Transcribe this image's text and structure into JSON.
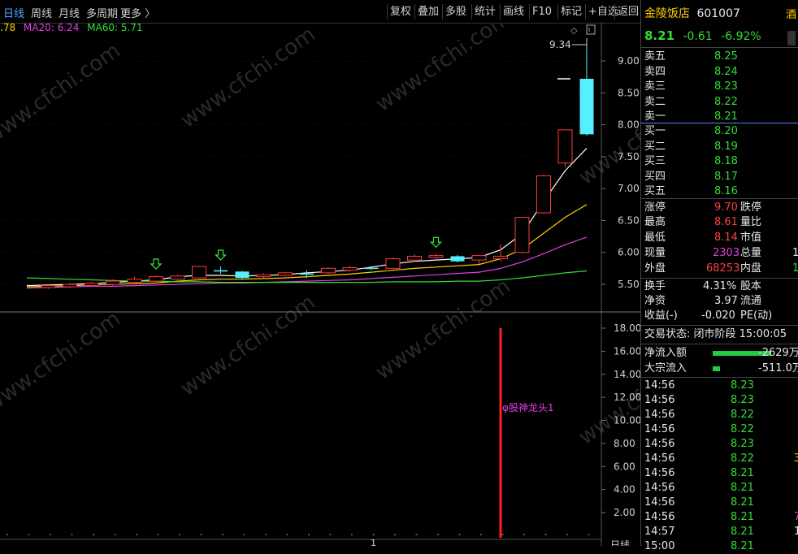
{
  "toolbar": {
    "periods": [
      "日线",
      "周线",
      "月线",
      "多周期",
      "更多 〉"
    ],
    "active_period": "日线",
    "buttons": [
      "复权",
      "叠加",
      "多股",
      "统计",
      "画线",
      "F10",
      "标记",
      "+自选",
      "返回"
    ]
  },
  "ma": {
    "ma_prefix": ".78",
    "ma20": "MA20: 6.24",
    "ma60": "MA60: 5.71",
    "colors": {
      "ma_prefix": "#ffd000",
      "ma20": "#e040e0",
      "ma60": "#33dd33"
    }
  },
  "price_axis": [
    "9.00",
    "8.50",
    "8.00",
    "7.50",
    "7.00",
    "6.50",
    "6.00",
    "5.50"
  ],
  "volume_axis": [
    "18.00",
    "16.00",
    "14.00",
    "12.00",
    "10.00",
    "8.00",
    "6.00",
    "4.00",
    "2.00"
  ],
  "annotations": {
    "high_label": "9.34",
    "indicator_label": "φ股神龙头1",
    "period_bottom": "日线",
    "bottom_marker": "1"
  },
  "stock": {
    "name": "金陵饭店",
    "code": "601007",
    "name_right_cut": "酒",
    "price": "8.21",
    "change": "-0.61",
    "change_pct": "-6.92%"
  },
  "order_book": {
    "sell": [
      {
        "label": "卖五",
        "price": "8.25"
      },
      {
        "label": "卖四",
        "price": "8.24"
      },
      {
        "label": "卖三",
        "price": "8.23"
      },
      {
        "label": "卖二",
        "price": "8.22"
      },
      {
        "label": "卖一",
        "price": "8.21"
      }
    ],
    "buy": [
      {
        "label": "买一",
        "price": "8.20"
      },
      {
        "label": "买二",
        "price": "8.19"
      },
      {
        "label": "买三",
        "price": "8.18"
      },
      {
        "label": "买四",
        "price": "8.17"
      },
      {
        "label": "买五",
        "price": "8.16"
      }
    ]
  },
  "quote": {
    "zhangting_label": "涨停",
    "zhangting": "9.70",
    "dieting_label": "跌停",
    "high_label": "最高",
    "high": "8.61",
    "liangbi_label": "量比",
    "low_label": "最低",
    "low": "8.14",
    "shizhi_label": "市值",
    "xianliang_label": "现量",
    "xianliang": "2303",
    "zongliang_label": "总量",
    "zongliang_cut": "1",
    "waipan_label": "外盘",
    "waipan": "68253",
    "neipan_label": "内盘",
    "neipan_cut": "1",
    "huanshou_label": "换手",
    "huanshou": "4.31%",
    "guben_label": "股本",
    "jingzi_label": "净资",
    "jingzi": "3.97",
    "liutong_label": "流通",
    "shouyi_label": "收益(-)",
    "shouyi": "-0.020",
    "pe_label": "PE(动)"
  },
  "status": {
    "label": "交易状态:",
    "value": "闭市阶段 15:00:05"
  },
  "flows": [
    {
      "label": "净流入额",
      "value": "-2629万",
      "bar_fraction": 1.0
    },
    {
      "label": "大宗流入",
      "value": "-511.0万",
      "bar_fraction": 0.12
    }
  ],
  "ticks": [
    {
      "time": "14:56",
      "price": "8.23",
      "vol_cut": ""
    },
    {
      "time": "14:56",
      "price": "8.23",
      "vol_cut": ""
    },
    {
      "time": "14:56",
      "price": "8.22",
      "vol_cut": ""
    },
    {
      "time": "14:56",
      "price": "8.22",
      "vol_cut": ""
    },
    {
      "time": "14:56",
      "price": "8.23",
      "vol_cut": ""
    },
    {
      "time": "14:56",
      "price": "8.22",
      "vol_cut": "3"
    },
    {
      "time": "14:56",
      "price": "8.21",
      "vol_cut": ""
    },
    {
      "time": "14:56",
      "price": "8.21",
      "vol_cut": ""
    },
    {
      "time": "14:56",
      "price": "8.21",
      "vol_cut": ""
    },
    {
      "time": "14:56",
      "price": "8.21",
      "vol_cut": "7"
    },
    {
      "time": "14:57",
      "price": "8.21",
      "vol_cut": "1"
    },
    {
      "time": "15:00",
      "price": "8.21",
      "vol_cut": ""
    }
  ],
  "watermark": "www.cfchi.com",
  "chart_data": {
    "type": "candlestick",
    "price_range": [
      5.3,
      9.4
    ],
    "volume_range": [
      0,
      19.5
    ],
    "candles": [
      {
        "o": 5.45,
        "c": 5.48,
        "h": 5.5,
        "l": 5.43,
        "up": true
      },
      {
        "o": 5.46,
        "c": 5.5,
        "h": 5.52,
        "l": 5.44,
        "up": true
      },
      {
        "o": 5.48,
        "c": 5.52,
        "h": 5.54,
        "l": 5.46,
        "up": true
      },
      {
        "o": 5.5,
        "c": 5.55,
        "h": 5.58,
        "l": 5.48,
        "up": true
      },
      {
        "o": 5.53,
        "c": 5.58,
        "h": 5.62,
        "l": 5.52,
        "up": true
      },
      {
        "o": 5.55,
        "c": 5.62,
        "h": 5.64,
        "l": 5.54,
        "up": true
      },
      {
        "o": 5.58,
        "c": 5.63,
        "h": 5.65,
        "l": 5.57,
        "up": true
      },
      {
        "o": 5.6,
        "c": 5.78,
        "h": 5.79,
        "l": 5.59,
        "up": true
      },
      {
        "o": 5.72,
        "c": 5.7,
        "h": 5.78,
        "l": 5.66,
        "up": false
      },
      {
        "o": 5.7,
        "c": 5.6,
        "h": 5.71,
        "l": 5.58,
        "up": false
      },
      {
        "o": 5.62,
        "c": 5.65,
        "h": 5.67,
        "l": 5.6,
        "up": true
      },
      {
        "o": 5.64,
        "c": 5.68,
        "h": 5.7,
        "l": 5.62,
        "up": true
      },
      {
        "o": 5.67,
        "c": 5.66,
        "h": 5.72,
        "l": 5.6,
        "up": false
      },
      {
        "o": 5.68,
        "c": 5.75,
        "h": 5.77,
        "l": 5.66,
        "up": true
      },
      {
        "o": 5.72,
        "c": 5.76,
        "h": 5.79,
        "l": 5.7,
        "up": true
      },
      {
        "o": 5.74,
        "c": 5.76,
        "h": 5.78,
        "l": 5.72,
        "up": false
      },
      {
        "o": 5.75,
        "c": 5.9,
        "h": 5.92,
        "l": 5.74,
        "up": true
      },
      {
        "o": 5.88,
        "c": 5.94,
        "h": 5.97,
        "l": 5.85,
        "up": true
      },
      {
        "o": 5.92,
        "c": 5.95,
        "h": 5.98,
        "l": 5.88,
        "up": true
      },
      {
        "o": 5.94,
        "c": 5.86,
        "h": 5.96,
        "l": 5.84,
        "up": false
      },
      {
        "o": 5.88,
        "c": 5.95,
        "h": 5.96,
        "l": 5.82,
        "up": true
      },
      {
        "o": 5.9,
        "c": 5.94,
        "h": 6.13,
        "l": 5.86,
        "up": true
      },
      {
        "o": 6.0,
        "c": 6.55,
        "h": 6.56,
        "l": 5.98,
        "up": true
      },
      {
        "o": 6.62,
        "c": 7.2,
        "h": 7.22,
        "l": 6.6,
        "up": true
      },
      {
        "o": 7.4,
        "c": 7.92,
        "h": 7.93,
        "l": 7.33,
        "up": true
      },
      {
        "o": 8.72,
        "c": 7.85,
        "h": 9.34,
        "l": 7.83,
        "up": false
      }
    ],
    "limit_mark": 8.72,
    "volume_bar": {
      "value": 18.0,
      "color": "#ff2020"
    },
    "ma_lines": [
      {
        "color": "#ffffff",
        "values": [
          5.48,
          5.49,
          5.5,
          5.51,
          5.53,
          5.55,
          5.57,
          5.62,
          5.64,
          5.64,
          5.63,
          5.64,
          5.65,
          5.68,
          5.7,
          5.72,
          5.77,
          5.82,
          5.86,
          5.88,
          5.9,
          5.92,
          6.04,
          6.29,
          6.8,
          7.28,
          7.63
        ]
      },
      {
        "color": "#ffd000",
        "values": [
          5.46,
          5.47,
          5.48,
          5.49,
          5.5,
          5.51,
          5.52,
          5.55,
          5.57,
          5.58,
          5.58,
          5.59,
          5.6,
          5.62,
          5.64,
          5.66,
          5.69,
          5.72,
          5.75,
          5.77,
          5.79,
          5.81,
          5.9,
          6.05,
          6.3,
          6.55,
          6.75
        ]
      },
      {
        "color": "#e040e0",
        "values": [
          5.44,
          5.45,
          5.46,
          5.47,
          5.47,
          5.48,
          5.49,
          5.5,
          5.51,
          5.52,
          5.52,
          5.53,
          5.54,
          5.55,
          5.56,
          5.57,
          5.59,
          5.61,
          5.63,
          5.65,
          5.67,
          5.69,
          5.75,
          5.85,
          5.98,
          6.12,
          6.24
        ]
      },
      {
        "color": "#33dd33",
        "values": [
          5.6,
          5.59,
          5.58,
          5.57,
          5.56,
          5.55,
          5.55,
          5.54,
          5.54,
          5.53,
          5.53,
          5.53,
          5.53,
          5.53,
          5.53,
          5.53,
          5.53,
          5.54,
          5.54,
          5.54,
          5.55,
          5.55,
          5.57,
          5.6,
          5.64,
          5.68,
          5.71
        ]
      }
    ],
    "signal_arrows": [
      5,
      8,
      18
    ]
  }
}
